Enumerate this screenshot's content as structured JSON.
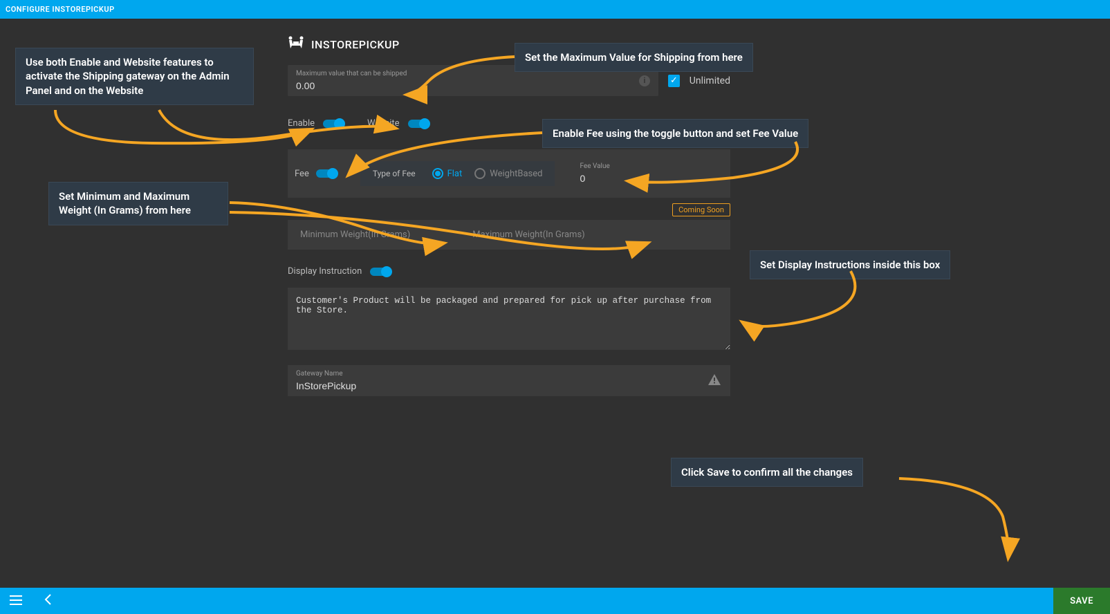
{
  "topbar": {
    "title": "CONFIGURE INSTOREPICKUP"
  },
  "form": {
    "header": "INSTOREPICKUP",
    "maxValue": {
      "label": "Maximum value that can be shipped",
      "value": "0.00"
    },
    "unlimited": {
      "label": "Unlimited",
      "checked": true
    },
    "toggles": {
      "enable": "Enable",
      "website": "Website"
    },
    "fee": {
      "label": "Fee",
      "typeLabel": "Type of Fee",
      "flat": "Flat",
      "weightBased": "WeightBased",
      "feeValueLabel": "Fee Value",
      "feeValue": "0"
    },
    "weight": {
      "min": "Minimum Weight(In Grams)",
      "max": "Maximum Weight(In Grams)",
      "badge": "Coming Soon"
    },
    "displayInstruction": {
      "label": "Display Instruction",
      "text": "Customer's Product will be packaged and prepared for pick up after purchase from the Store."
    },
    "gateway": {
      "label": "Gateway Name",
      "value": "InStorePickup"
    }
  },
  "bottombar": {
    "save": "SAVE"
  },
  "annotations": {
    "a1": "Use both Enable and Website features to activate the Shipping gateway on the Admin Panel and on the Website",
    "a2": "Set the Maximum Value for Shipping from here",
    "a3": "Enable Fee using the toggle button and set Fee Value",
    "a4": "Set Minimum and Maximum Weight (In Grams) from here",
    "a5": "Set Display Instructions inside this box",
    "a6": "Click Save to confirm all the changes"
  }
}
